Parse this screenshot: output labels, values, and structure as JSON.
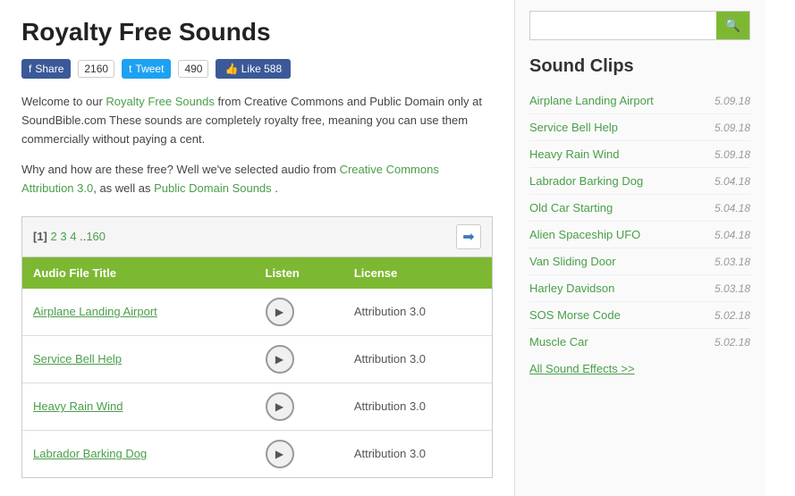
{
  "page": {
    "title": "Royalty Free Sounds"
  },
  "social": {
    "fb_share": "Share",
    "fb_count": "2160",
    "tw_tweet": "Tweet",
    "tw_count": "490",
    "like_label": "Like 588"
  },
  "intro": {
    "line1_prefix": "Welcome to our ",
    "line1_link": "Royalty Free Sounds",
    "line1_suffix": " from Creative Commons and Public Domain only at SoundBible.com These sounds are completely royalty free, meaning you can use them commercially without paying a cent.",
    "line2_prefix": "Why and how are these free? Well we've selected audio from ",
    "line2_link1": "Creative Commons Attribution 3.0",
    "line2_mid": ", as well as ",
    "line2_link2": "Public Domain Sounds",
    "line2_suffix": " ."
  },
  "table": {
    "nav": {
      "pages": "[1] 2 3 4 ..160"
    },
    "headers": [
      "Audio File Title",
      "Listen",
      "License"
    ],
    "rows": [
      {
        "title": "Airplane Landing Airport",
        "license": "Attribution 3.0"
      },
      {
        "title": "Service Bell Help",
        "license": "Attribution 3.0"
      },
      {
        "title": "Heavy Rain Wind",
        "license": "Attribution 3.0"
      },
      {
        "title": "Labrador Barking Dog",
        "license": "Attribution 3.0"
      }
    ]
  },
  "sidebar": {
    "search_placeholder": "",
    "sound_clips_title": "Sound Clips",
    "clips": [
      {
        "name": "Airplane Landing Airport",
        "date": "5.09.18"
      },
      {
        "name": "Service Bell Help",
        "date": "5.09.18"
      },
      {
        "name": "Heavy Rain Wind",
        "date": "5.09.18"
      },
      {
        "name": "Labrador Barking Dog",
        "date": "5.04.18"
      },
      {
        "name": "Old Car Starting",
        "date": "5.04.18"
      },
      {
        "name": "Alien Spaceship UFO",
        "date": "5.04.18"
      },
      {
        "name": "Van Sliding Door",
        "date": "5.03.18"
      },
      {
        "name": "Harley Davidson",
        "date": "5.03.18"
      },
      {
        "name": "SOS Morse Code",
        "date": "5.02.18"
      },
      {
        "name": "Muscle Car",
        "date": "5.02.18"
      }
    ],
    "all_effects": "All Sound Effects >>"
  }
}
